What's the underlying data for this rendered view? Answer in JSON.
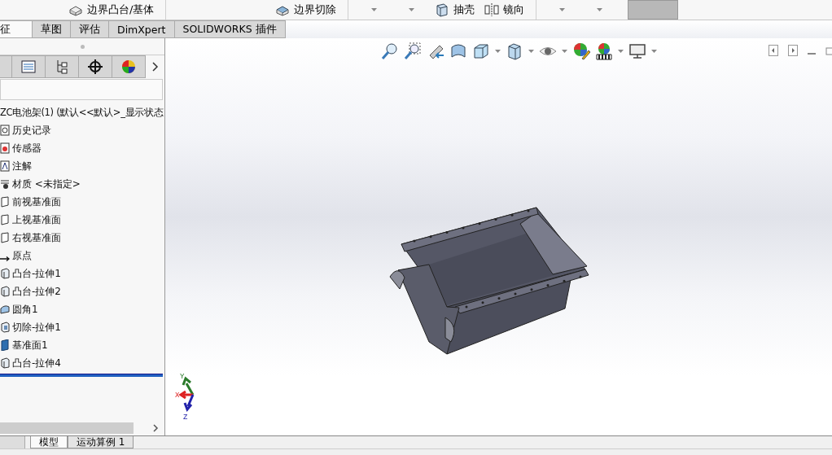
{
  "ribbon": {
    "buttons": [
      {
        "label": "边界凸台/基体",
        "kind": "boss"
      },
      {
        "label": "边界切除",
        "kind": "cut"
      },
      {
        "label": "抽壳",
        "kind": "shell"
      },
      {
        "label": "镜向",
        "kind": "mirror"
      }
    ]
  },
  "command_tabs": [
    {
      "label": "征",
      "selected": true
    },
    {
      "label": "草图",
      "selected": false
    },
    {
      "label": "评估",
      "selected": false
    },
    {
      "label": "DimXpert",
      "selected": false
    },
    {
      "label": "SOLIDWORKS 插件",
      "selected": false
    }
  ],
  "feature_tree": {
    "root": "ZC电池架(1)  (默认<<默认>_显示状态",
    "items": [
      {
        "label": "历史记录",
        "kind": "history"
      },
      {
        "label": "传感器",
        "kind": "sensor"
      },
      {
        "label": "注解",
        "kind": "annotation"
      },
      {
        "label": "材质 <未指定>",
        "kind": "material"
      },
      {
        "label": "前视基准面",
        "kind": "plane"
      },
      {
        "label": "上视基准面",
        "kind": "plane"
      },
      {
        "label": "右视基准面",
        "kind": "plane"
      },
      {
        "label": "原点",
        "kind": "origin"
      },
      {
        "label": "凸台-拉伸1",
        "kind": "extrude"
      },
      {
        "label": "凸台-拉伸2",
        "kind": "extrude"
      },
      {
        "label": "圆角1",
        "kind": "fillet"
      },
      {
        "label": "切除-拉伸1",
        "kind": "cut"
      },
      {
        "label": "基准面1",
        "kind": "refplane"
      },
      {
        "label": "凸台-拉伸4",
        "kind": "extrude"
      }
    ]
  },
  "triad": {
    "x": "X",
    "y": "Y",
    "z": "Z"
  },
  "bottom_tabs": [
    {
      "label": "模型",
      "selected": true
    },
    {
      "label": "运动算例 1",
      "selected": false
    }
  ]
}
